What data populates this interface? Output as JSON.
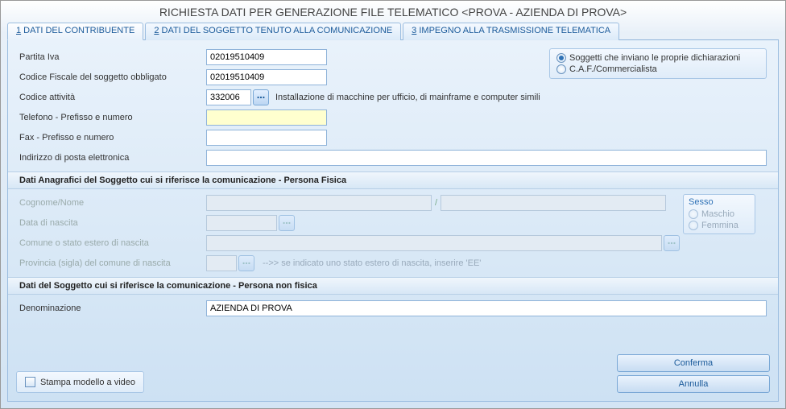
{
  "title": "RICHIESTA DATI PER GENERAZIONE FILE TELEMATICO <PROVA - AZIENDA DI PROVA>",
  "tabs": [
    {
      "num": "1",
      "label": " DATI DEL CONTRIBUENTE"
    },
    {
      "num": "2",
      "label": " DATI DEL SOGGETTO TENUTO ALLA COMUNICAZIONE"
    },
    {
      "num": "3",
      "label": " IMPEGNO ALLA TRASMISSIONE TELEMATICA"
    }
  ],
  "fields": {
    "piva_label": "Partita Iva",
    "piva_value": "02019510409",
    "cf_label": "Codice Fiscale del soggetto obbligato",
    "cf_value": "02019510409",
    "attivita_label": "Codice attività",
    "attivita_value": "332006",
    "attivita_desc": "Installazione di macchine per ufficio, di mainframe e computer simili",
    "tel_label": "Telefono - Prefisso e numero",
    "tel_value": "",
    "fax_label": "Fax - Prefisso e numero",
    "fax_value": "",
    "email_label": "Indirizzo di posta elettronica",
    "email_value": ""
  },
  "sender": {
    "opt1": "Soggetti che inviano le proprie dichiarazioni",
    "opt2": "C.A.F./Commercialista",
    "selected": "opt1"
  },
  "section_pf": "Dati Anagrafici del Soggetto cui si riferisce la comunicazione - Persona Fisica",
  "pf": {
    "cognome_label": "Cognome/Nome",
    "data_label": "Data di nascita",
    "comune_label": "Comune o stato estero di nascita",
    "prov_label": "Provincia (sigla) del comune di nascita",
    "prov_hint": "-->> se indicato uno stato estero di nascita, inserire 'EE'"
  },
  "sesso": {
    "title": "Sesso",
    "m": "Maschio",
    "f": "Femmina"
  },
  "section_pnf": "Dati del Soggetto cui si riferisce la comunicazione - Persona non fisica",
  "pnf": {
    "denom_label": "Denominazione",
    "denom_value": "AZIENDA DI PROVA"
  },
  "stampa_label": "Stampa modello a video",
  "btn_confirm": "Conferma",
  "btn_cancel": "Annulla"
}
